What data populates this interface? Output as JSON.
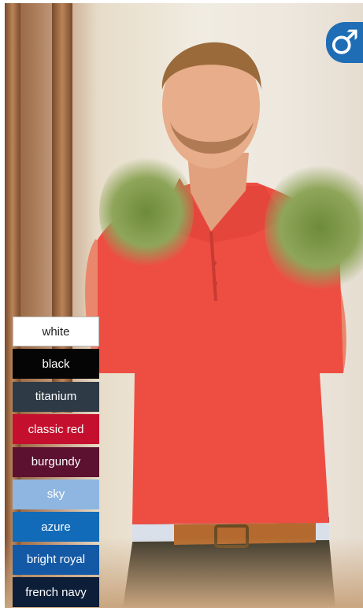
{
  "gender_badge": {
    "icon": "male-symbol-icon",
    "glyph": "♂",
    "color": "#1e6db5"
  },
  "photo": {
    "subject": "model-wearing-red-polo-shirt",
    "shirt_color": "#ee4e42"
  },
  "colors": [
    {
      "label": "white",
      "hex": "#ffffff"
    },
    {
      "label": "black",
      "hex": "#050505"
    },
    {
      "label": "titanium",
      "hex": "#2e3b47"
    },
    {
      "label": "classic red",
      "hex": "#c4102e"
    },
    {
      "label": "burgundy",
      "hex": "#5c1130"
    },
    {
      "label": "sky",
      "hex": "#8fb6e0"
    },
    {
      "label": "azure",
      "hex": "#126bb8"
    },
    {
      "label": "bright royal",
      "hex": "#1459a6"
    },
    {
      "label": "french navy",
      "hex": "#0d1e38"
    }
  ]
}
